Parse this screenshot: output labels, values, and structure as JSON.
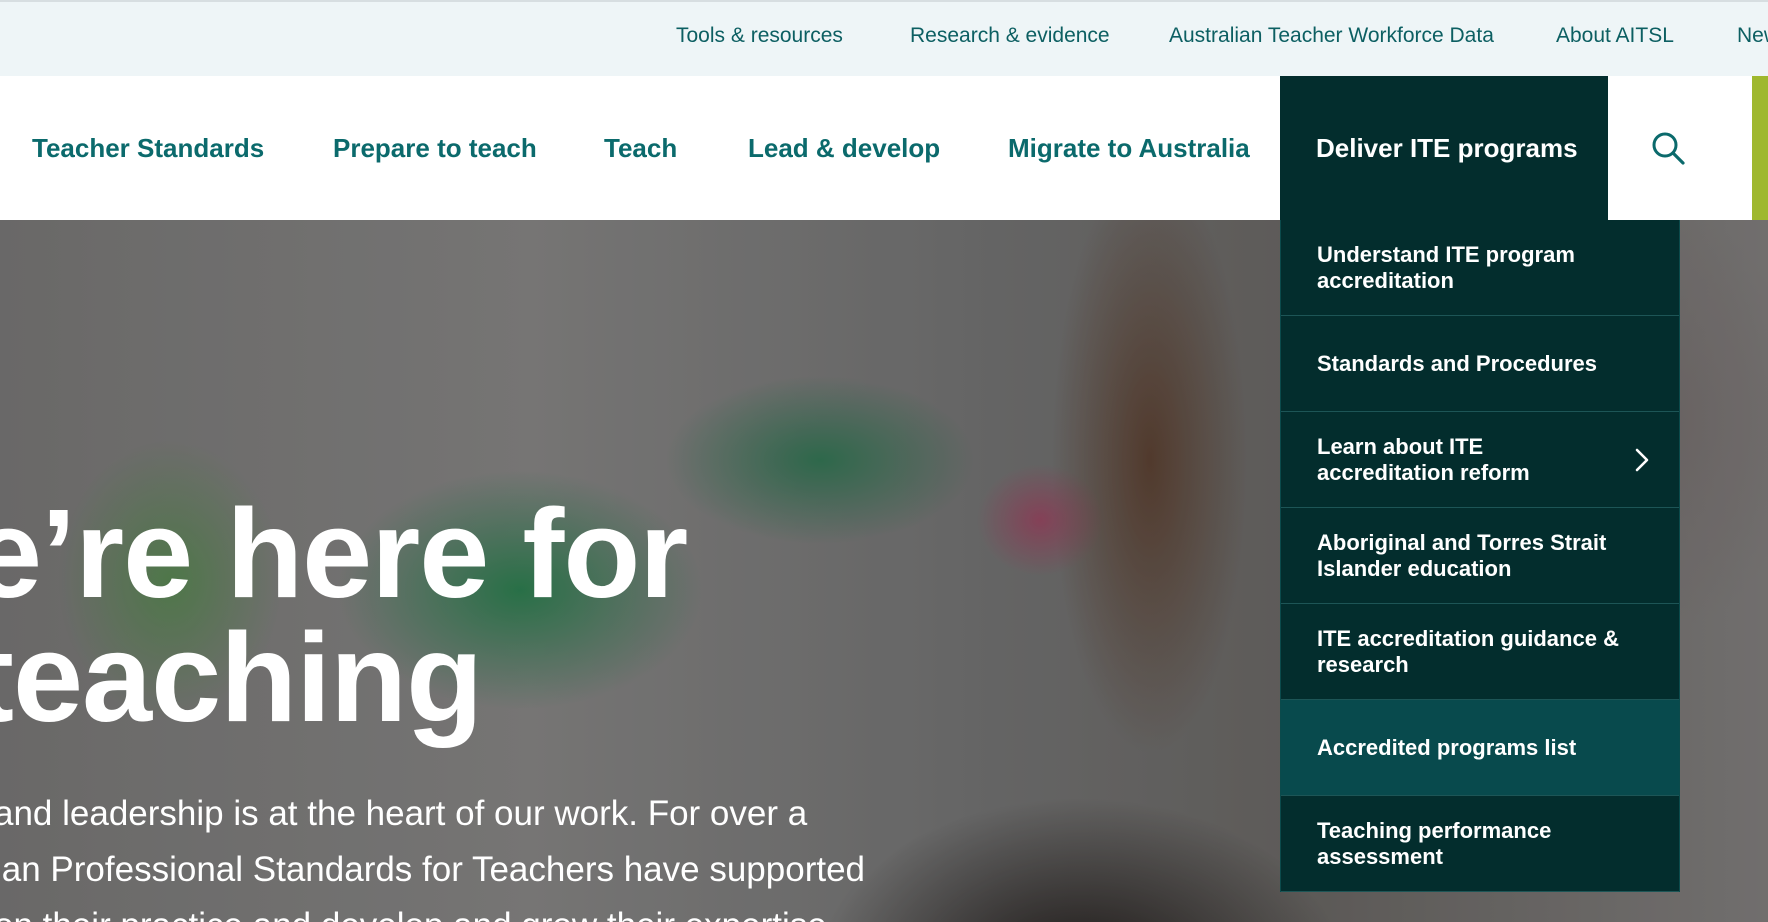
{
  "utility_nav": {
    "items": [
      "Tools & resources",
      "Research & evidence",
      "Australian Teacher Workforce Data",
      "About AITSL",
      "New"
    ]
  },
  "main_nav": {
    "items": [
      "Teacher Standards",
      "Prepare to teach",
      "Teach",
      "Lead & develop",
      "Migrate to Australia"
    ],
    "active": "Deliver ITE programs",
    "search_icon": "search-icon"
  },
  "dropdown": {
    "items": [
      "Understand ITE program accreditation",
      "Standards and Procedures",
      "Learn about ITE accreditation reform",
      "Aboriginal and Torres Strait Islander education",
      "ITE accreditation guidance & research",
      "Accredited programs list",
      "Teaching performance assessment"
    ],
    "highlighted_item": "Accredited programs list",
    "submenu_icon": "chevron-right-icon"
  },
  "hero": {
    "heading_line1": "e’re here for",
    "heading_line2": " teaching",
    "body_line1": " and leadership is at the heart of our work. For over a",
    "body_line2": "ian Professional Standards for Teachers have supported",
    "body_line3": "on their practice and develop and grow their expertise"
  },
  "colors": {
    "brand_teal": "#0b6a6c",
    "dark_teal": "#032d2d",
    "highlight_teal": "#084a4d",
    "accent_green": "#9fb82e",
    "utility_bg": "#eef5f7"
  }
}
